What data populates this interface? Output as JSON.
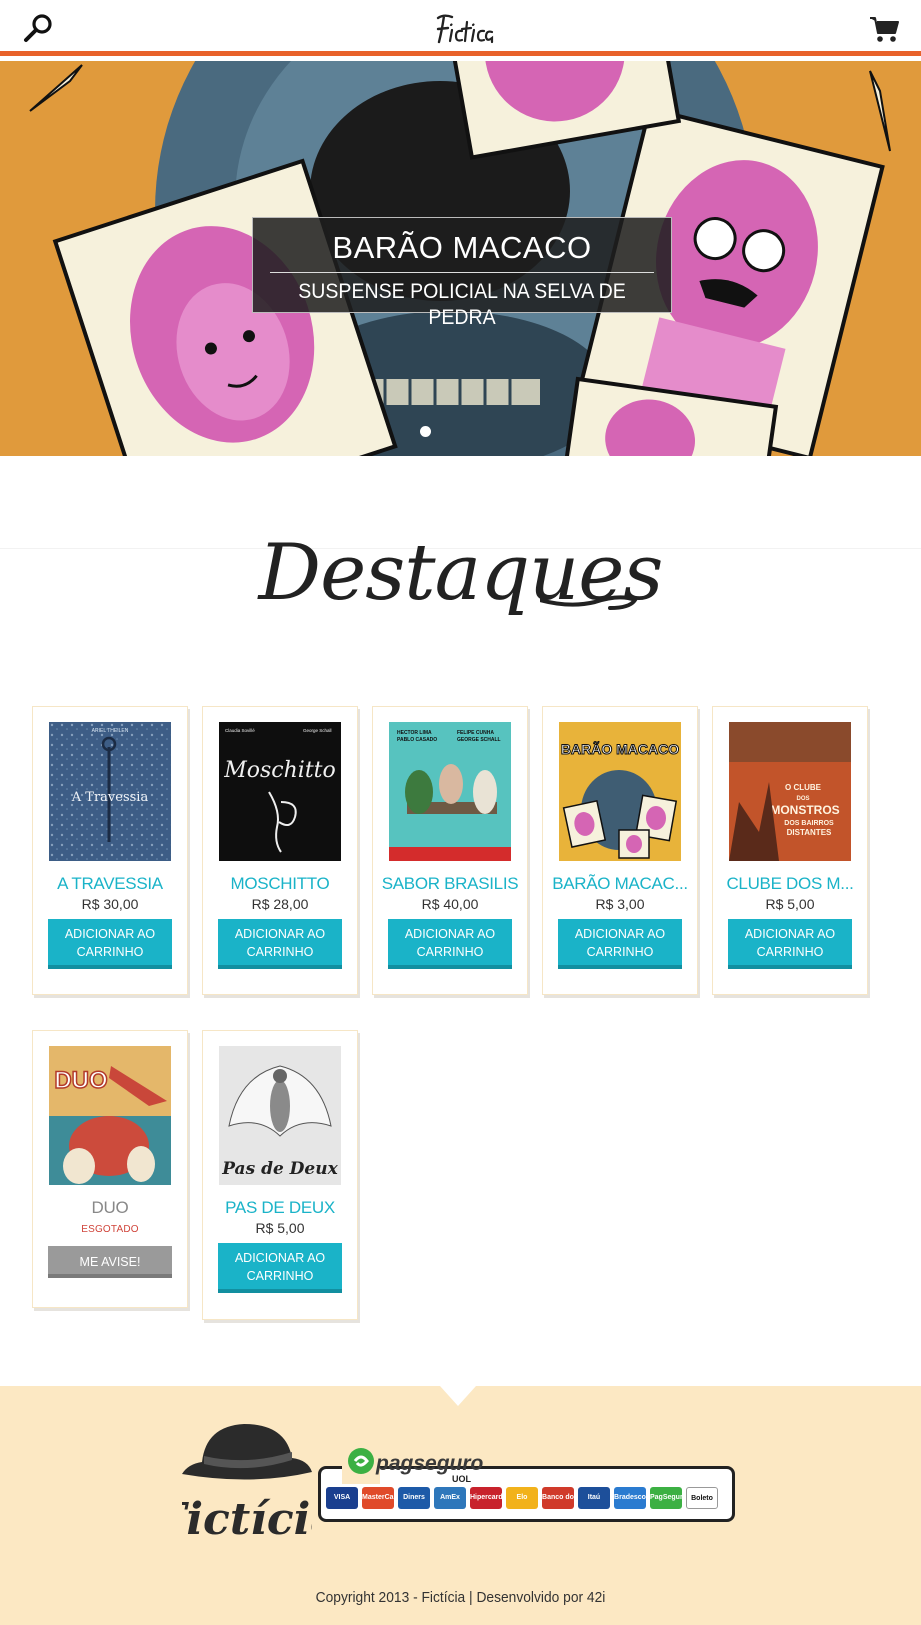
{
  "header": {
    "search_icon": "search-icon",
    "logo_text": "Fictícia",
    "cart_icon": "cart-icon"
  },
  "hero": {
    "title": "BARÃO MACACO",
    "subtitle": "SUSPENSE POLICIAL NA SELVA DE PEDRA",
    "slide_count": 1,
    "active_slide": 1,
    "background_color": "#e09a3c"
  },
  "section": {
    "title": "Destaques"
  },
  "products": [
    {
      "name": "A TRAVESSIA",
      "price": "R$ 30,00",
      "button": "ADICIONAR AO CARRINHO",
      "available": true
    },
    {
      "name": "MOSCHITTO",
      "price": "R$ 28,00",
      "button": "ADICIONAR AO CARRINHO",
      "available": true
    },
    {
      "name": "SABOR BRASILIS",
      "price": "R$ 40,00",
      "button": "ADICIONAR AO CARRINHO",
      "available": true
    },
    {
      "name": "BARÃO MACAC...",
      "price": "R$ 3,00",
      "button": "ADICIONAR AO CARRINHO",
      "available": true
    },
    {
      "name": "CLUBE DOS M...",
      "price": "R$ 5,00",
      "button": "ADICIONAR AO CARRINHO",
      "available": true
    },
    {
      "name": "DUO",
      "status": "ESGOTADO",
      "button": "ME AVISE!",
      "available": false
    },
    {
      "name": "PAS DE DEUX",
      "price": "R$ 5,00",
      "button": "ADICIONAR AO CARRINHO",
      "available": true
    }
  ],
  "covers": {
    "a_travessia": {
      "author": "ARIEL THEILEN",
      "title": "A Travessia"
    },
    "moschitto": {
      "authors": [
        "Claudia Sovillé",
        "George Schall"
      ],
      "title": "Moschitto"
    },
    "sabor_brasilis": {
      "authors": [
        "HECTOR LIMA",
        "FELIPE CUNHA",
        "PABLO CASADO",
        "GEORGE SCHALL"
      ]
    },
    "barao_macaco": {
      "title": "BARÃO MACACO"
    },
    "clube": {
      "title_parts": [
        "O CLUBE",
        "DOS",
        "MONSTROS",
        "DOS BAIRROS",
        "DISTANTES"
      ]
    },
    "duo": {
      "title": "DUO"
    },
    "pas_de_deux": {
      "title": "Pas de Deux"
    }
  },
  "footer": {
    "brand": "Fictícia",
    "payment_provider": "pagseguro",
    "payment_provider_sub": "UOL",
    "payment_methods": [
      "VISA",
      "MasterCard",
      "Diners",
      "AmEx",
      "Hipercard",
      "Elo",
      "Banco do Brasil",
      "Itaú",
      "Bradesco",
      "PagSeguro",
      "Boleto"
    ],
    "copyright": "Copyright 2013 - Fictícia | Desenvolvido por 42i"
  },
  "colors": {
    "accent_orange": "#e8622a",
    "button_teal": "#1ab3c8",
    "footer_bg": "#fce8c3",
    "sold_out_red": "#d0443a"
  }
}
